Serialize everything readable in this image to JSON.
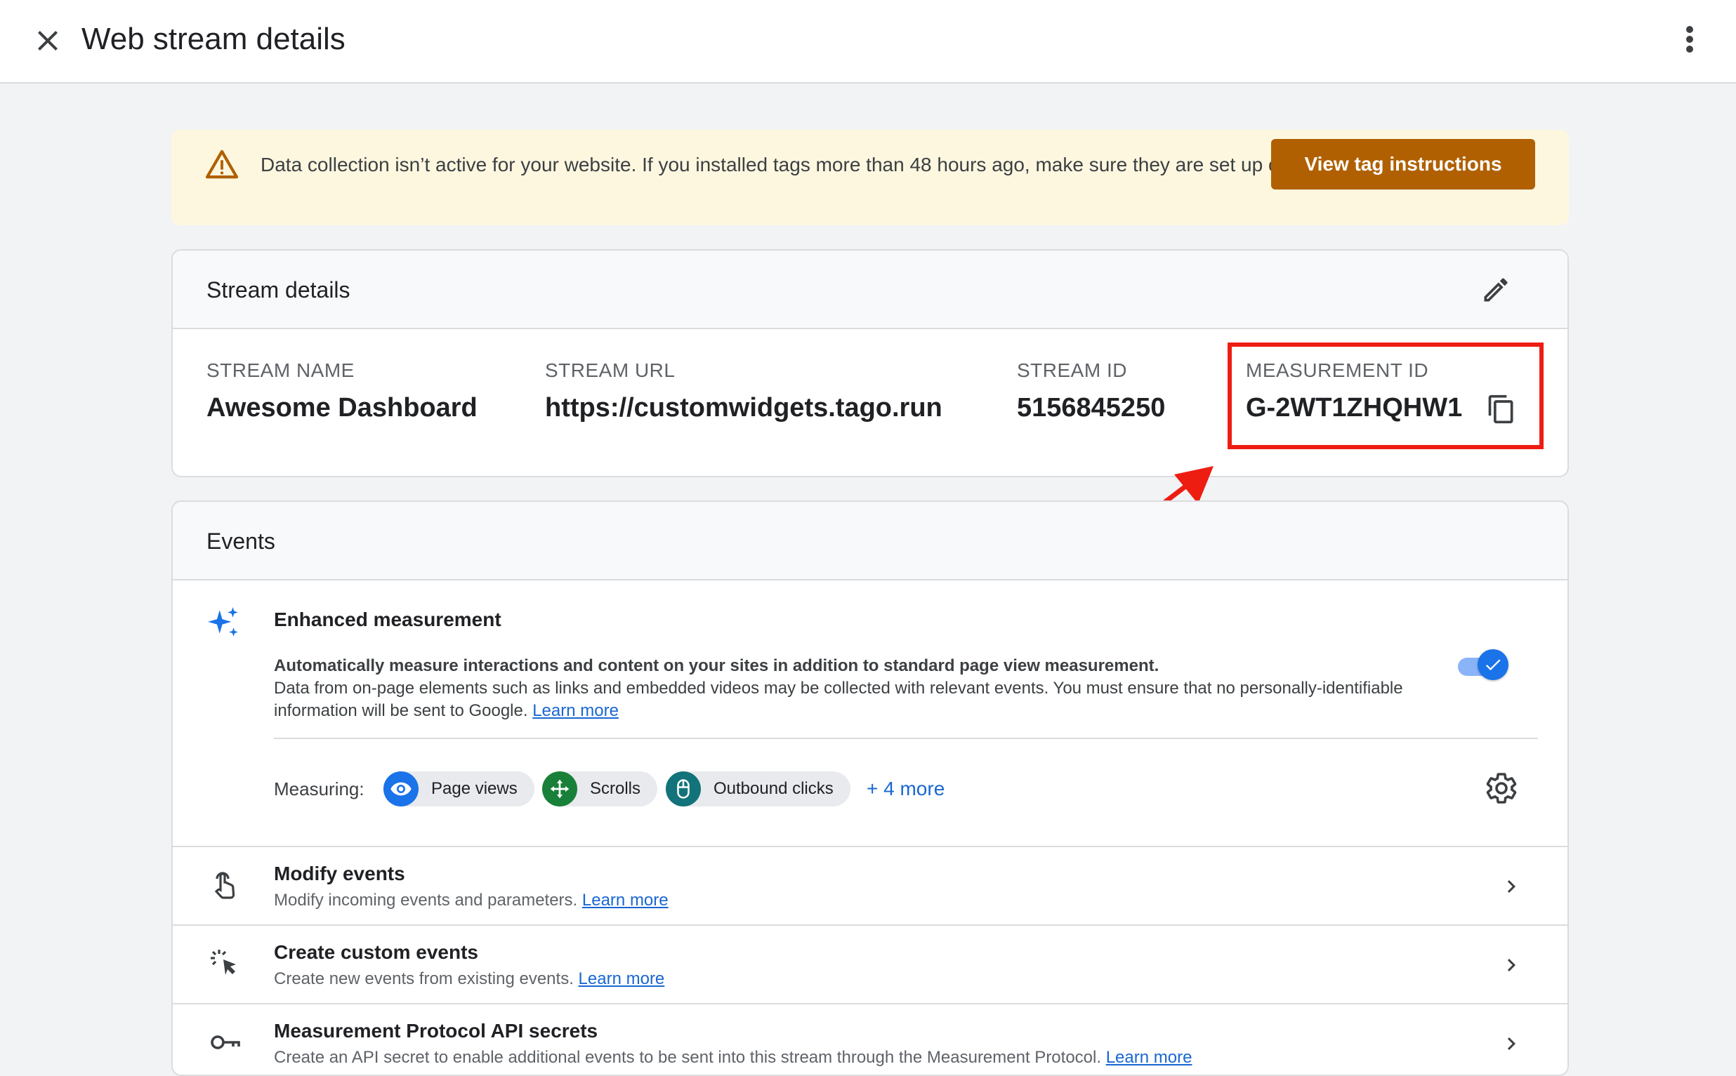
{
  "header": {
    "title": "Web stream details"
  },
  "alert": {
    "message": "Data collection isn’t active for your website. If you installed tags more than 48 hours ago, make sure they are set up correctly.",
    "button_label": "View tag instructions"
  },
  "stream_details": {
    "title": "Stream details",
    "fields": [
      {
        "label": "STREAM NAME",
        "value": "Awesome Dashboard"
      },
      {
        "label": "STREAM URL",
        "value": "https://customwidgets.tago.run"
      },
      {
        "label": "STREAM ID",
        "value": "5156845250"
      },
      {
        "label": "MEASUREMENT ID",
        "value": "G-2WT1ZHQHW1"
      }
    ]
  },
  "events": {
    "title": "Events",
    "enhanced": {
      "title": "Enhanced measurement",
      "desc_bold": "Automatically measure interactions and content on your sites in addition to standard page view measurement.",
      "desc": "Data from on-page elements such as links and embedded videos may be collected with relevant events. You must ensure that no personally-identifiable information will be sent to Google.",
      "learn_more": "Learn more",
      "toggle_on": true,
      "measuring_label": "Measuring:",
      "chips": [
        {
          "label": "Page views",
          "icon": "eye-icon",
          "color": "#1a73e8"
        },
        {
          "label": "Scrolls",
          "icon": "move-icon",
          "color": "#188038"
        },
        {
          "label": "Outbound clicks",
          "icon": "mouse-icon",
          "color": "#12737a"
        }
      ],
      "more_label": "+ 4 more"
    },
    "rows": [
      {
        "title": "Modify events",
        "subtitle": "Modify incoming events and parameters.",
        "link": "Learn more",
        "icon": "touch-icon"
      },
      {
        "title": "Create custom events",
        "subtitle": "Create new events from existing events.",
        "link": "Learn more",
        "icon": "click-icon"
      },
      {
        "title": "Measurement Protocol API secrets",
        "subtitle": "Create an API secret to enable additional events to be sent into this stream through the Measurement Protocol.",
        "link": "Learn more",
        "icon": "key-icon"
      }
    ]
  },
  "colors": {
    "accent": "#1a73e8",
    "warning_button": "#b06000",
    "annotation": "#ee1d12"
  }
}
